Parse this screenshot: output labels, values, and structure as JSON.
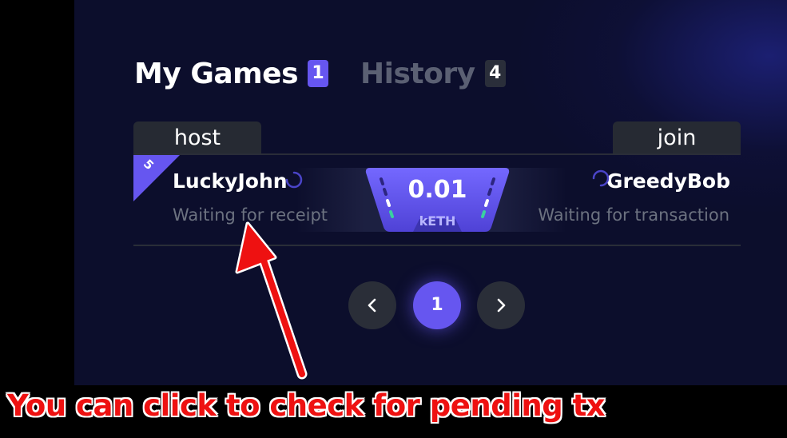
{
  "tabs": [
    {
      "label": "My Games",
      "count": "1"
    },
    {
      "label": "History",
      "count": "4"
    }
  ],
  "table": {
    "host_header": "host",
    "join_header": "join"
  },
  "game": {
    "rank": "5",
    "host": {
      "name": "LuckyJohn",
      "status": "Waiting for receipt"
    },
    "join": {
      "name": "GreedyBob",
      "status": "Waiting for transaction"
    },
    "bet": {
      "value": "0.01",
      "unit": "kETH"
    }
  },
  "pagination": {
    "current_page": "1"
  },
  "annotation": {
    "text": "You can click to check for pending tx"
  },
  "colors": {
    "accent": "#6656f0",
    "annotation": "#ee1111"
  },
  "icons": {
    "prev": "chevron-left-icon",
    "next": "chevron-right-icon",
    "loading": "spinner-icon"
  }
}
